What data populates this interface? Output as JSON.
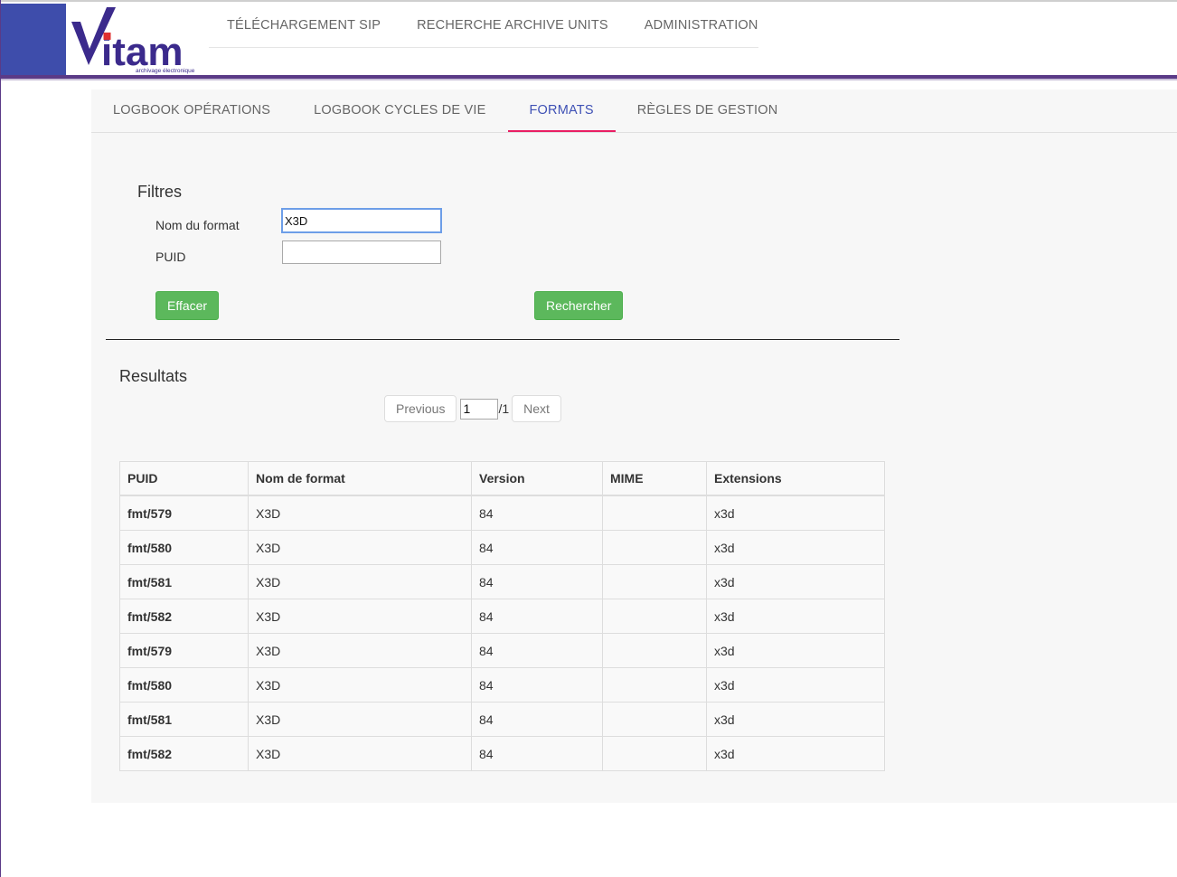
{
  "header": {
    "logo_text": "Vitam",
    "logo_tagline": "archivage électronique",
    "nav": [
      {
        "label": "TÉLÉCHARGEMENT SIP"
      },
      {
        "label": "RECHERCHE ARCHIVE UNITS"
      },
      {
        "label": "ADMINISTRATION"
      }
    ]
  },
  "tabs": [
    {
      "label": "LOGBOOK OPÉRATIONS",
      "active": false
    },
    {
      "label": "LOGBOOK CYCLES DE VIE",
      "active": false
    },
    {
      "label": "FORMATS",
      "active": true
    },
    {
      "label": "RÈGLES DE GESTION",
      "active": false
    }
  ],
  "filters": {
    "title": "Filtres",
    "format_name_label": "Nom du format",
    "format_name_value": "X3D",
    "puid_label": "PUID",
    "puid_value": "",
    "clear_label": "Effacer",
    "search_label": "Rechercher"
  },
  "results": {
    "title": "Resultats",
    "pagination": {
      "previous_label": "Previous",
      "next_label": "Next",
      "current_page": "1",
      "total_pages": "/1"
    },
    "columns": [
      "PUID",
      "Nom de format",
      "Version",
      "MIME",
      "Extensions"
    ],
    "rows": [
      [
        "fmt/579",
        "X3D",
        "84",
        "",
        "x3d"
      ],
      [
        "fmt/580",
        "X3D",
        "84",
        "",
        "x3d"
      ],
      [
        "fmt/581",
        "X3D",
        "84",
        "",
        "x3d"
      ],
      [
        "fmt/582",
        "X3D",
        "84",
        "",
        "x3d"
      ],
      [
        "fmt/579",
        "X3D",
        "84",
        "",
        "x3d"
      ],
      [
        "fmt/580",
        "X3D",
        "84",
        "",
        "x3d"
      ],
      [
        "fmt/581",
        "X3D",
        "84",
        "",
        "x3d"
      ],
      [
        "fmt/582",
        "X3D",
        "84",
        "",
        "x3d"
      ]
    ]
  },
  "colors": {
    "brand_purple": "#5b3a87",
    "brand_blue": "#3e4dab",
    "active_tab_text": "#3f51b5",
    "active_tab_underline": "#e91e63",
    "button_green": "#5cb85c",
    "logo_red": "#e03030"
  }
}
